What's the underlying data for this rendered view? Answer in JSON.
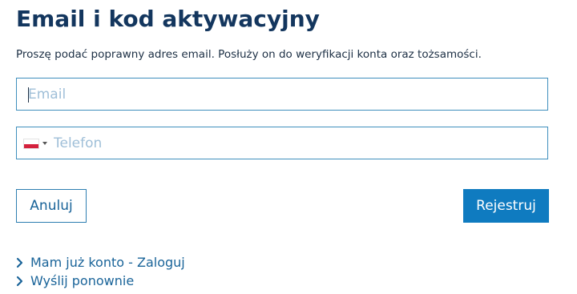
{
  "page": {
    "title": "Email i kod aktywacyjny",
    "description": "Proszę podać poprawny adres email. Posłuży on do weryfikacji konta oraz tożsamości."
  },
  "form": {
    "email": {
      "value": "",
      "placeholder": "Email"
    },
    "phone": {
      "value": "",
      "placeholder": "Telefon",
      "country_flag_icon": "poland-flag-icon"
    }
  },
  "buttons": {
    "cancel_label": "Anuluj",
    "register_label": "Rejestruj"
  },
  "links": [
    {
      "label": "Mam już konto - Zaloguj",
      "icon": "chevron-right-icon"
    },
    {
      "label": "Wyślij ponownie",
      "icon": "chevron-right-icon"
    }
  ],
  "colors": {
    "primary": "#0f7bc0",
    "title": "#13365e",
    "link": "#1a6499",
    "border": "#3f8fbd",
    "placeholder": "#9fbfd8"
  }
}
